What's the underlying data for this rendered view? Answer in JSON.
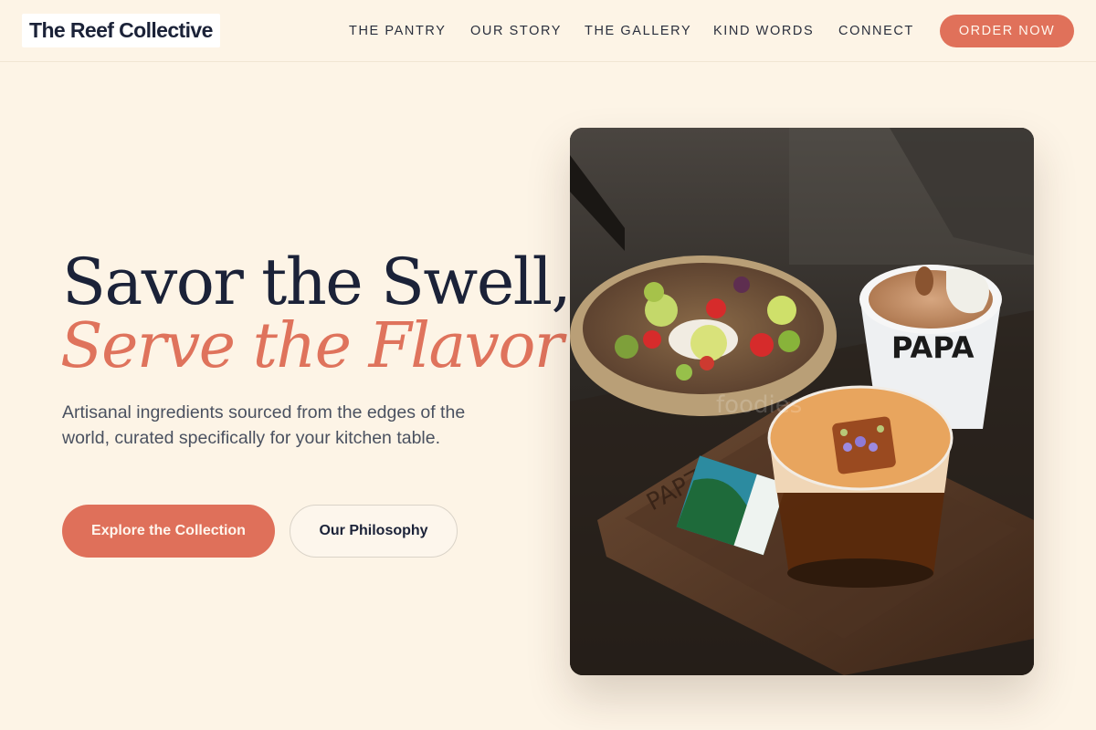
{
  "header": {
    "logo": "The Reef Collective",
    "nav": [
      {
        "label": "THE PANTRY"
      },
      {
        "label": "OUR STORY"
      },
      {
        "label": "THE GALLERY"
      },
      {
        "label": "KIND WORDS"
      },
      {
        "label": "CONNECT"
      }
    ],
    "cta": "ORDER NOW"
  },
  "hero": {
    "headline_line1": "Savor the Swell,",
    "headline_line2": "Serve the Flavor",
    "subtext": "Artisanal ingredients sourced from the edges of the world, curated specifically for your kitchen table.",
    "primary_button": "Explore the Collection",
    "secondary_button": "Our Philosophy",
    "image": {
      "cup_text": "PAPA",
      "tray_text": "PAPZZ",
      "watermark": "foodies"
    }
  },
  "colors": {
    "background": "#fdf4e6",
    "accent": "#df705a",
    "text_dark": "#1b2238",
    "text_muted": "#4a5160"
  }
}
